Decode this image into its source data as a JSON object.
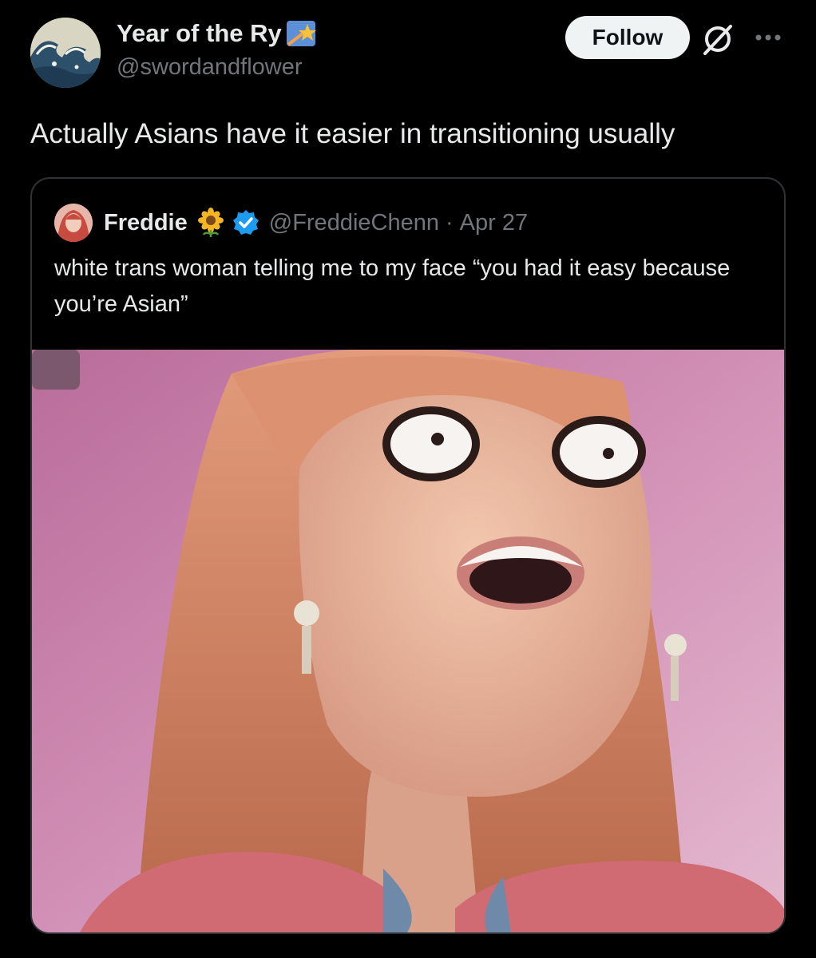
{
  "author": {
    "display_name": "Year of the Ry",
    "name_emoji": "shooting-star-emoji",
    "handle": "@swordandflower",
    "avatar": "wave-artwork-avatar"
  },
  "actions": {
    "follow_label": "Follow",
    "grok_icon": "grok-icon",
    "more_icon": "more-options-icon"
  },
  "tweet": {
    "text": "Actually Asians have it easier in transitioning usually"
  },
  "quoted": {
    "display_name": "Freddie",
    "badge_emoji": "sunflower-emoji",
    "verified": true,
    "handle": "@FreddieChenn",
    "separator": "·",
    "date": "Apr 27",
    "text": "white trans woman telling me to my face “you had it easy because you’re Asian”",
    "media": "animated-doll-face-image"
  },
  "colors": {
    "background": "#000000",
    "text_primary": "#e7e9ea",
    "text_secondary": "#71767b",
    "follow_bg": "#eff3f4",
    "verified_blue": "#1d9bf0",
    "border": "#2f3336"
  }
}
